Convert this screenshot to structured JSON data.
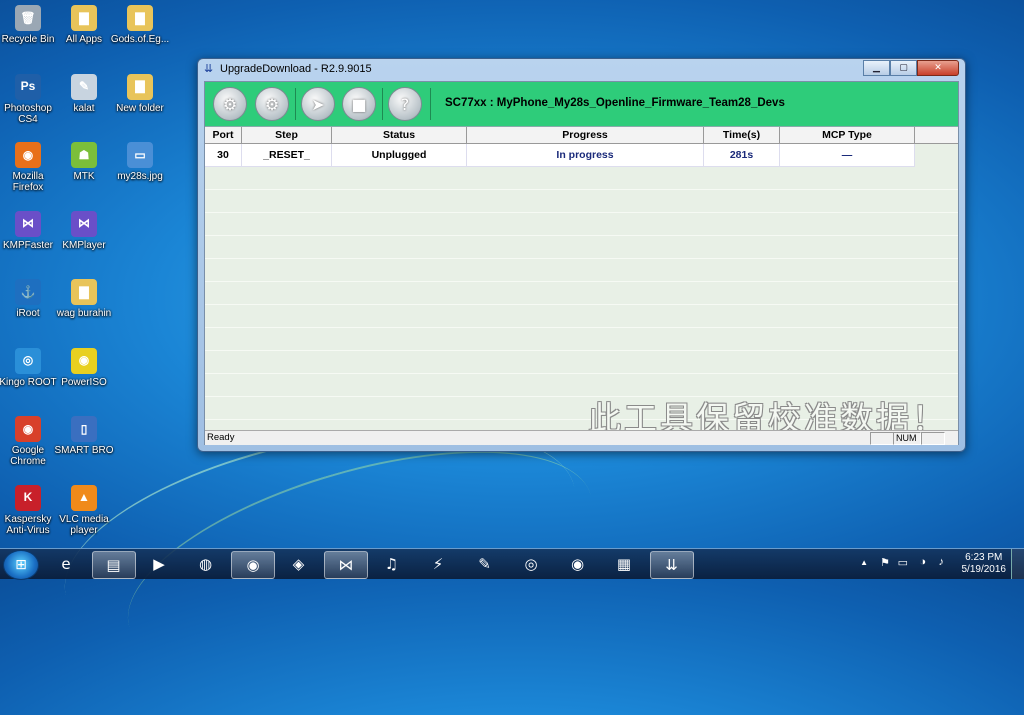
{
  "desktop": {
    "icons": [
      {
        "label": "Recycle Bin",
        "glyph": "🗑",
        "color": "#9aa7b4"
      },
      {
        "label": "All Apps",
        "glyph": "▇",
        "color": "#e8c45a"
      },
      {
        "label": "Gods.of.Eg...",
        "glyph": "▇",
        "color": "#e8c45a"
      },
      {
        "label": "Photoshop CS4",
        "glyph": "Ps",
        "color": "#1f5fa8"
      },
      {
        "label": "kalat",
        "glyph": "✎",
        "color": "#c8d4e0"
      },
      {
        "label": "New folder",
        "glyph": "▇",
        "color": "#e8c45a"
      },
      {
        "label": "Mozilla Firefox",
        "glyph": "◉",
        "color": "#e8701a"
      },
      {
        "label": "MTK",
        "glyph": "☗",
        "color": "#7bbf3a"
      },
      {
        "label": "my28s.jpg",
        "glyph": "▭",
        "color": "#4a8fd6"
      },
      {
        "label": "KMPFaster",
        "glyph": "⋈",
        "color": "#6a4fc8"
      },
      {
        "label": "KMPlayer",
        "glyph": "⋈",
        "color": "#6a4fc8"
      },
      {
        "label": "iRoot",
        "glyph": "⚓",
        "color": "#1e6fc0"
      },
      {
        "label": "wag burahin",
        "glyph": "▇",
        "color": "#e8c45a"
      },
      {
        "label": "Kingo ROOT",
        "glyph": "◎",
        "color": "#2a8fd8"
      },
      {
        "label": "PowerISO",
        "glyph": "◉",
        "color": "#e8d020"
      },
      {
        "label": "Google Chrome",
        "glyph": "◉",
        "color": "#d8402a"
      },
      {
        "label": "SMART BRO",
        "glyph": "▯",
        "color": "#3a6fc0"
      },
      {
        "label": "Kaspersky Anti-Virus",
        "glyph": "K",
        "color": "#c8202a"
      },
      {
        "label": "VLC media player",
        "glyph": "▲",
        "color": "#f08a1a"
      }
    ]
  },
  "window": {
    "title": "UpgradeDownload - R2.9.9015",
    "controls": {
      "minimize": "▁",
      "maximize": "▢",
      "close": "✕"
    },
    "toolbar": {
      "buttons": [
        {
          "name": "settings",
          "glyph": "⚙"
        },
        {
          "name": "advanced-settings",
          "glyph": "⚙"
        },
        {
          "name": "start",
          "glyph": "➤"
        },
        {
          "name": "stop",
          "glyph": "■"
        },
        {
          "name": "help",
          "glyph": "?"
        }
      ],
      "product": "SC77xx : MyPhone_My28s_Openline_Firmware_Team28_Devs"
    },
    "table": {
      "columns": [
        "Port",
        "Step",
        "Status",
        "Progress",
        "Time(s)",
        "MCP Type"
      ],
      "rows": [
        {
          "port": "30",
          "step": "_RESET_",
          "status": "Unplugged",
          "progress": "In progress",
          "time": "281s",
          "mcp": "—"
        }
      ]
    },
    "watermark": "此工具保留校准数据！",
    "status": {
      "text": "Ready",
      "num": "NUM"
    }
  },
  "taskbar": {
    "start_glyph": "⊞",
    "apps": [
      {
        "name": "internet-explorer",
        "glyph": "e",
        "active": false
      },
      {
        "name": "file-explorer",
        "glyph": "▤",
        "active": true
      },
      {
        "name": "media-player",
        "glyph": "▶",
        "active": false
      },
      {
        "name": "globe",
        "glyph": "◍",
        "active": false
      },
      {
        "name": "chrome",
        "glyph": "◉",
        "active": true
      },
      {
        "name": "network-tool",
        "glyph": "◈",
        "active": false
      },
      {
        "name": "kmplayer",
        "glyph": "⋈",
        "active": true
      },
      {
        "name": "itunes",
        "glyph": "♫",
        "active": false
      },
      {
        "name": "flash-tool",
        "glyph": "⚡",
        "active": false
      },
      {
        "name": "paint",
        "glyph": "✎",
        "active": false
      },
      {
        "name": "messenger",
        "glyph": "◎",
        "active": false
      },
      {
        "name": "firefox",
        "glyph": "◉",
        "active": false
      },
      {
        "name": "winrar",
        "glyph": "▦",
        "active": false
      },
      {
        "name": "upgrade-download",
        "glyph": "⇊",
        "active": true
      }
    ],
    "tray": {
      "chevron": "▲",
      "icons": [
        "⚑",
        "▭",
        "◑",
        "♪"
      ]
    },
    "time": "6:23 PM",
    "date": "5/19/2016"
  }
}
